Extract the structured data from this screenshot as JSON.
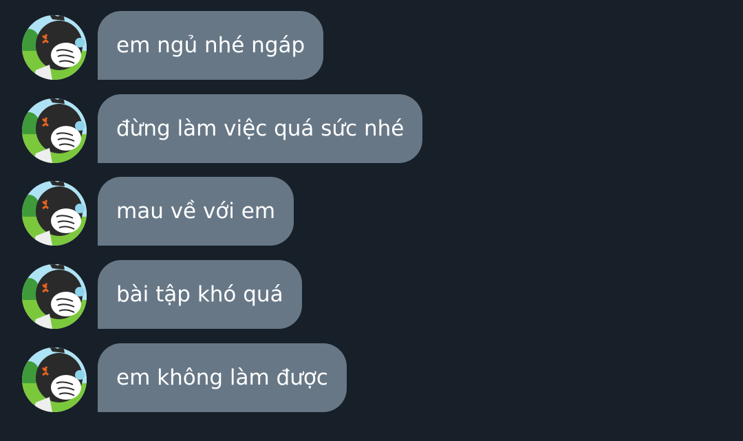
{
  "chat": {
    "messages": [
      {
        "text": "em ngủ nhé ngáp",
        "avatar_icon": "angry-cartoon-character-avatar-icon"
      },
      {
        "text": "đừng làm việc quá sức nhé",
        "avatar_icon": "angry-cartoon-character-avatar-icon"
      },
      {
        "text": "mau về với em",
        "avatar_icon": "angry-cartoon-character-avatar-icon"
      },
      {
        "text": "bài tập khó quá",
        "avatar_icon": "angry-cartoon-character-avatar-icon"
      },
      {
        "text": "em không làm được",
        "avatar_icon": "angry-cartoon-character-avatar-icon"
      }
    ]
  },
  "colors": {
    "background": "#171f29",
    "bubble": "#677786",
    "bubble_text": "#ffffff",
    "avatar_sky": "#aee3f5",
    "avatar_grass": "#7cc83c",
    "avatar_character": "#2a2a2a",
    "anger_mark": "#e8641e"
  }
}
